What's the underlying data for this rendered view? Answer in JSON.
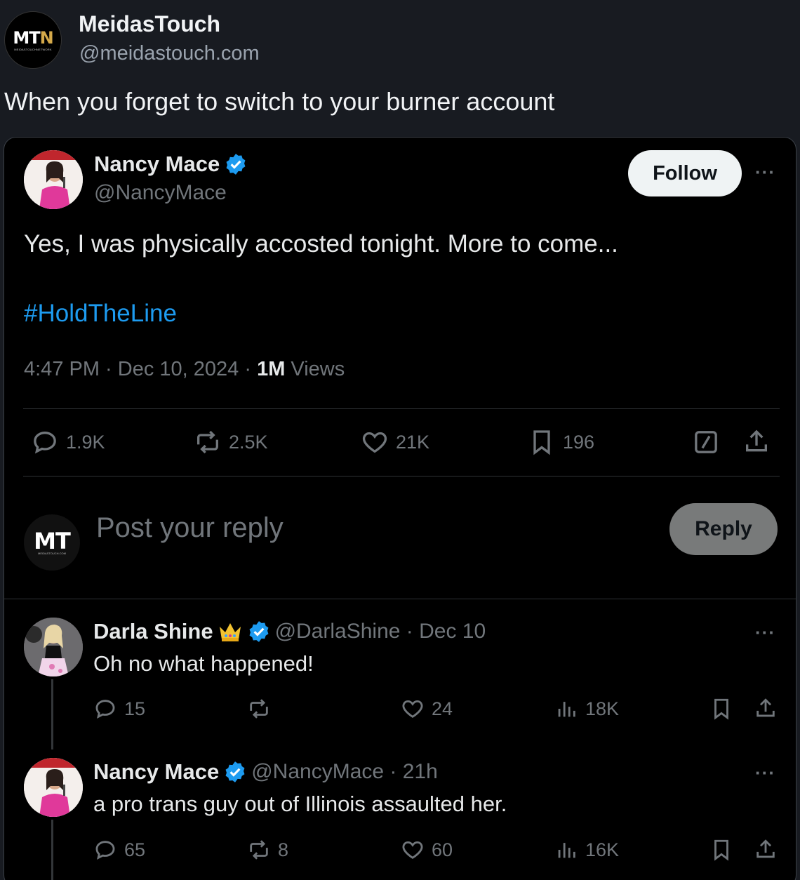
{
  "outer": {
    "logo_main": "MT",
    "logo_accent": "N",
    "logo_sub": "MEIDASTOUCHNETWORK",
    "name": "MeidasTouch",
    "handle": "@meidastouch.com",
    "text": "When you forget to switch to your burner account"
  },
  "tweet": {
    "name": "Nancy Mace",
    "handle": "@NancyMace",
    "follow_label": "Follow",
    "more": "···",
    "text": "Yes, I was physically accosted tonight. More to come...",
    "hashtag": "#HoldTheLine",
    "time": "4:47 PM · Dec 10, 2024 · ",
    "views_count": "1M",
    "views_label": " Views",
    "stats": {
      "replies": "1.9K",
      "reposts": "2.5K",
      "likes": "21K",
      "bookmarks": "196"
    }
  },
  "reply_box": {
    "logo": "MT",
    "logo_sub": "MEIDASTOUCH.COM",
    "placeholder": "Post your reply",
    "button": "Reply"
  },
  "replies": [
    {
      "name": "Darla Shine",
      "handle_time": "@DarlaShine · Dec 10",
      "text": "Oh no what happened!",
      "more": "···",
      "replies": "15",
      "reposts": "",
      "likes": "24",
      "views": "18K"
    },
    {
      "name": "Nancy Mace",
      "handle_time": "@NancyMace · 21h",
      "text": "a pro trans guy out of Illinois assaulted her.",
      "more": "···",
      "replies": "65",
      "reposts": "8",
      "likes": "60",
      "views": "16K"
    }
  ],
  "colors": {
    "background": "#181b21",
    "card": "#000000",
    "accent_blue": "#1d9bf0",
    "muted": "#71767b",
    "logo_gold": "#d4a94a"
  },
  "icons": [
    "reply-icon",
    "repost-icon",
    "like-icon",
    "bookmark-icon",
    "grok-icon",
    "share-icon",
    "views-icon",
    "verified-icon",
    "crown-icon"
  ]
}
